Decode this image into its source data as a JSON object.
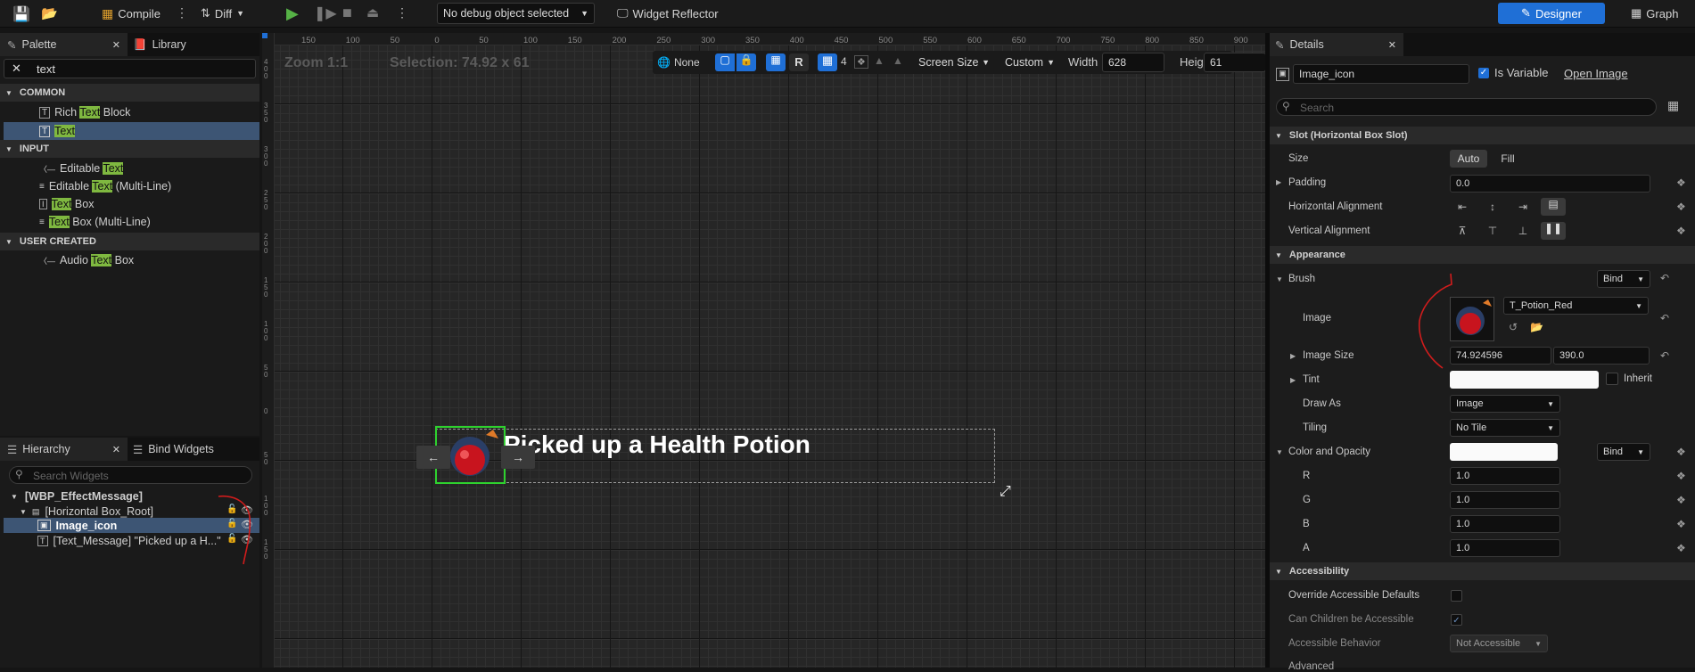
{
  "toolbar": {
    "compile": "Compile",
    "diff": "Diff",
    "debug_object": "No debug object selected",
    "widget_reflector": "Widget Reflector",
    "designer": "Designer",
    "graph": "Graph"
  },
  "palette": {
    "tab": "Palette",
    "library_tab": "Library",
    "search_value": "text",
    "sections": [
      {
        "name": "COMMON",
        "items": [
          {
            "pre": "Rich ",
            "hl": "Text",
            "post": " Block"
          },
          {
            "pre": "",
            "hl": "Text",
            "post": ""
          }
        ]
      },
      {
        "name": "INPUT",
        "items": [
          {
            "pre": "Editable ",
            "hl": "Text",
            "post": ""
          },
          {
            "pre": "Editable ",
            "hl": "Text",
            "post": " (Multi-Line)"
          },
          {
            "pre": "",
            "hl": "Text",
            "post": " Box"
          },
          {
            "pre": "",
            "hl": "Text",
            "post": " Box (Multi-Line)"
          }
        ]
      },
      {
        "name": "USER CREATED",
        "items": [
          {
            "pre": "Audio ",
            "hl": "Text",
            "post": " Box"
          }
        ]
      }
    ]
  },
  "hierarchy": {
    "tab": "Hierarchy",
    "bind_tab": "Bind Widgets",
    "search_placeholder": "Search Widgets",
    "root": "[WBP_EffectMessage]",
    "hbox": "[Horizontal Box_Root]",
    "image": "Image_icon",
    "text": "[Text_Message] \"Picked up a H...\""
  },
  "canvas": {
    "zoom": "Zoom 1:1",
    "selection": "Selection: 74.92 x 61",
    "none": "None",
    "r": "R",
    "grid_num": "4",
    "screen_size": "Screen Size",
    "custom": "Custom",
    "width_label": "Width",
    "width_value": "628",
    "height_label": "Height",
    "height_value": "61",
    "message": "Picked up a Health Potion",
    "ruler_top": [
      "150",
      "100",
      "50",
      "0",
      "50",
      "100",
      "150",
      "200",
      "250",
      "300",
      "350",
      "400",
      "450",
      "500",
      "550",
      "600",
      "650",
      "700",
      "750",
      "800",
      "850",
      "900"
    ],
    "ruler_left": [
      "400",
      "350",
      "300",
      "250",
      "200",
      "150",
      "100",
      "50",
      "0",
      "50",
      "100",
      "150"
    ],
    "arrow_left": "←",
    "arrow_right": "→"
  },
  "details": {
    "tab": "Details",
    "name_value": "Image_icon",
    "is_variable": "Is Variable",
    "open_image": "Open Image",
    "search_placeholder": "Search",
    "slot_section": "Slot (Horizontal Box Slot)",
    "size": "Size",
    "auto": "Auto",
    "fill": "Fill",
    "padding": "Padding",
    "padding_value": "0.0",
    "h_align": "Horizontal Alignment",
    "v_align": "Vertical Alignment",
    "appearance": "Appearance",
    "brush": "Brush",
    "bind": "Bind",
    "image": "Image",
    "image_asset": "T_Potion_Red",
    "image_size": "Image Size",
    "image_size_x": "74.924596",
    "image_size_y": "390.0",
    "tint": "Tint",
    "inherit": "Inherit",
    "draw_as": "Draw As",
    "draw_as_value": "Image",
    "tiling": "Tiling",
    "tiling_value": "No Tile",
    "color_opacity": "Color and Opacity",
    "r": "R",
    "g": "G",
    "b": "B",
    "a": "A",
    "r_val": "1.0",
    "g_val": "1.0",
    "b_val": "1.0",
    "a_val": "1.0",
    "accessibility": "Accessibility",
    "override": "Override Accessible Defaults",
    "children": "Can Children be Accessible",
    "behavior": "Accessible Behavior",
    "behavior_value": "Not Accessible",
    "advanced": "Advanced"
  },
  "colors": {
    "accent": "#1f6fd6",
    "highlight": "#7fb840",
    "selection": "#2ed12e",
    "annotation": "#d01c1c"
  }
}
